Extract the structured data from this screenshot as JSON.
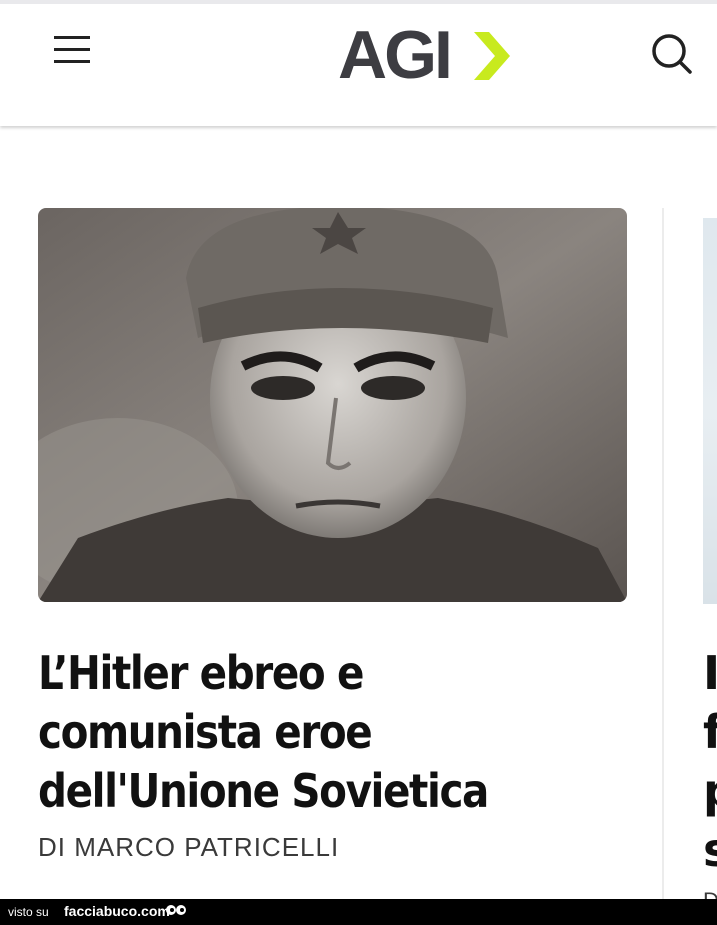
{
  "header": {
    "logo_text": "AGI",
    "menu_icon": "hamburger-menu-icon",
    "search_icon": "search-icon",
    "brand_color": "#3d3d42",
    "accent_color": "#c8ea1e"
  },
  "article": {
    "headline_lines": [
      "L’Hitler ebreo e",
      "comunista eroe",
      "dell'Unione Sovietica"
    ],
    "byline": "DI MARCO PATRICELLI"
  },
  "next_article": {
    "title_letters": "I\nf\np\ns",
    "byline_letter": "D"
  },
  "footer": {
    "prefix": "visto su",
    "site": "facciabuco.com"
  }
}
